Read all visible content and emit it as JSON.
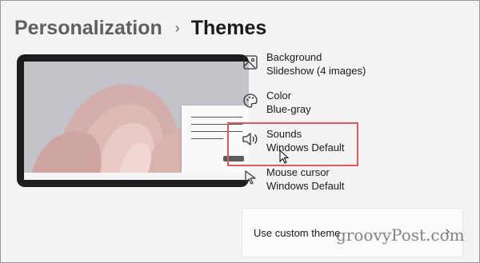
{
  "breadcrumb": {
    "parent": "Personalization",
    "separator": "›",
    "current": "Themes"
  },
  "settings": [
    {
      "title": "Background",
      "value": "Slideshow (4 images)",
      "icon": "image-icon"
    },
    {
      "title": "Color",
      "value": "Blue-gray",
      "icon": "palette-icon"
    },
    {
      "title": "Sounds",
      "value": "Windows Default",
      "icon": "speaker-icon"
    },
    {
      "title": "Mouse cursor",
      "value": "Windows Default",
      "icon": "mouse-cursor-icon"
    }
  ],
  "custom_theme": {
    "label": "Use custom theme",
    "chevron": "›"
  },
  "watermark": "groovyPost.com",
  "colors": {
    "highlight": "#e0595b",
    "background": "#f3f3f3"
  }
}
